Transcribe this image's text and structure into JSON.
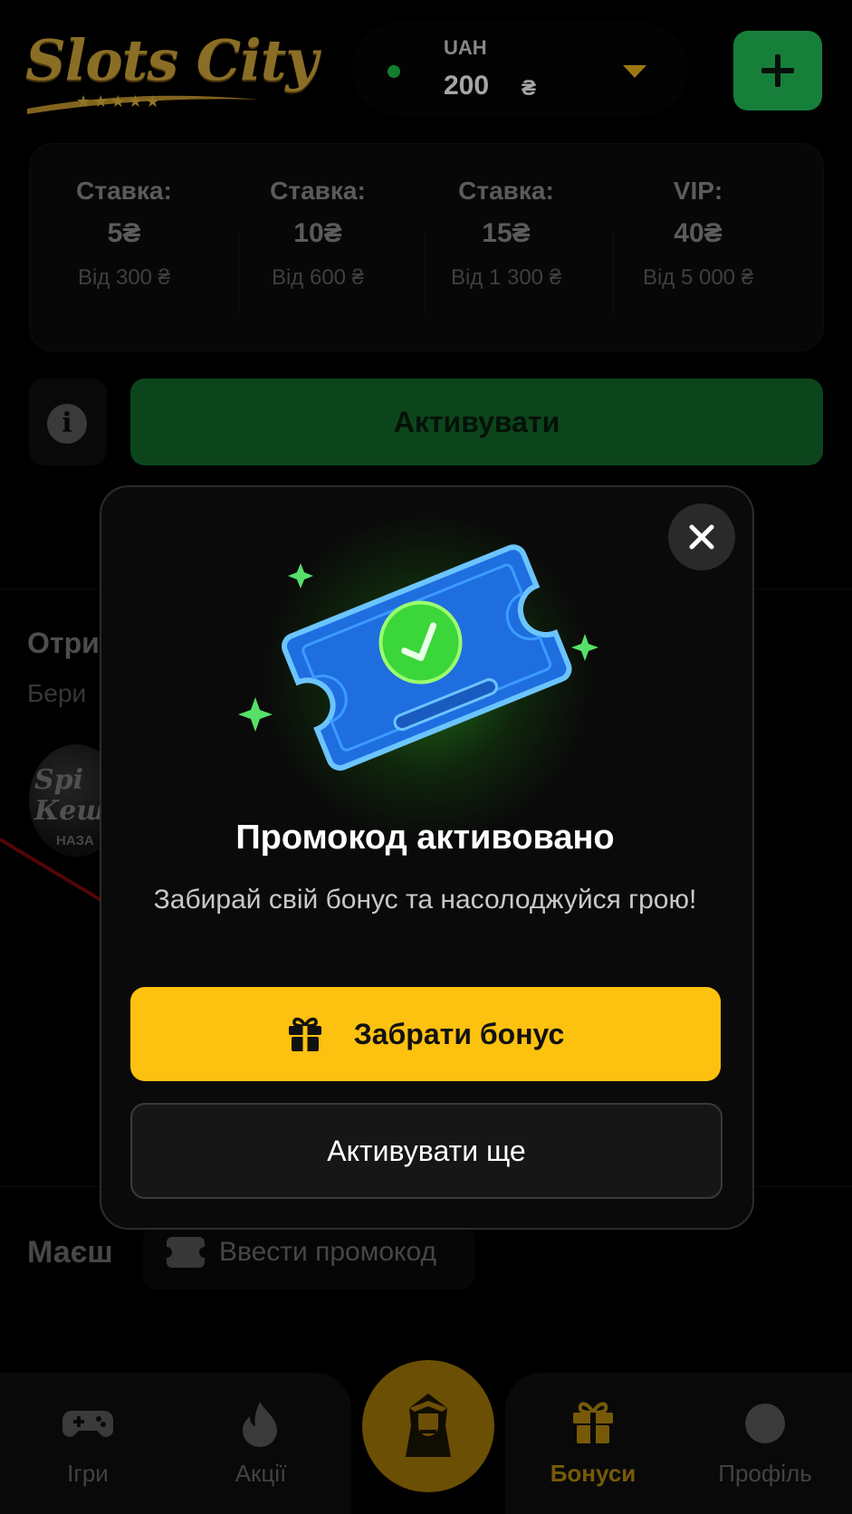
{
  "header": {
    "logo_text": "Slots City",
    "logo_stars": "★★★★★",
    "currency": "UAH",
    "balance": "200",
    "currency_symbol": "₴"
  },
  "stakes": [
    {
      "title": "Ставка:",
      "value": "5₴",
      "subtitle": "Від 300 ₴"
    },
    {
      "title": "Ставка:",
      "value": "10₴",
      "subtitle": "Від 600 ₴"
    },
    {
      "title": "Ставка:",
      "value": "15₴",
      "subtitle": "Від 1 300 ₴"
    },
    {
      "title": "VIP:",
      "value": "40₴",
      "subtitle": "Від 5 000 ₴"
    }
  ],
  "info_glyph": "i",
  "activate_label": "Активувати",
  "background_section": {
    "heading": "Отри",
    "subtitle": "Бери",
    "badge_text": "Spi\nКеш",
    "badge_small": "НАЗА"
  },
  "promo_row": {
    "label": "Маєш",
    "input_placeholder": "Ввести промокод"
  },
  "bottom_nav": {
    "items": [
      {
        "label": "Ігри",
        "icon": "gamepad-icon"
      },
      {
        "label": "Акції",
        "icon": "flame-icon"
      },
      {
        "label": "Бонуси",
        "icon": "gift-icon",
        "active": true
      },
      {
        "label": "Профіль",
        "icon": "profile-icon"
      }
    ],
    "center_icon": "pharaoh-icon"
  },
  "modal": {
    "title": "Промокод активовано",
    "subtitle": "Забирай свій бонус та насолоджуйся грою!",
    "primary_button": "Забрати бонус",
    "secondary_button": "Активувати ще",
    "close_icon": "close-icon",
    "illustration": "ticket-check-icon"
  },
  "colors": {
    "accent_green": "#22c45a",
    "activate_green": "#136b2c",
    "primary_yellow": "#fdc10f",
    "balance_caret": "#f2b91b",
    "active_nav": "#b78a0d",
    "ticket_blue": "#1e6ee0"
  }
}
